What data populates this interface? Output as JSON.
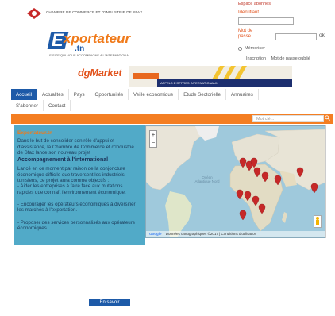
{
  "header": {
    "org_name": "CHAMBRE DE COMMERCE ET D'INDUSTRIE DE SFAX",
    "logo": {
      "brand": "xportateur",
      "e_letter": "E",
      "tld": ".tn",
      "slogan": "LE SITE QUI VOUS ACCOMPAGNE A L'INTERNATIONAL"
    }
  },
  "login": {
    "title": "Espace abonnés",
    "identifiant_label": "Identifiant",
    "password_label": "Mot de passe",
    "ok_label": "ok",
    "remember_label": "Mémoriser",
    "signup_link": "Inscription",
    "forgot_link": "Mot de passe oublié"
  },
  "banner": {
    "brand": "dgMarket",
    "promo_text": "APPELS D'OFFRES INTERNATIONAUX"
  },
  "nav": {
    "row1": [
      "Accueil",
      "Actualités",
      "Pays",
      "Opportunités",
      "Veille économique",
      "Etude Sectorielle",
      "Annuaires"
    ],
    "row2": [
      "S'abonner",
      "Contact"
    ],
    "active": "Accueil"
  },
  "search": {
    "placeholder": "Mot clé..."
  },
  "intro": {
    "title": "Exportateur.tn",
    "p1": "Dans le but de consolider son rôle d'appui et d'assistance, la Chambre de Commerce et d'Industrie de Sfax lance son nouveau projet",
    "heading": "Accompagnement à l'international",
    "p2": "Lancé en ce moment par raison de la conjoncture économique difficile que traversent les industriels tunisiens, ce projet aura comme objectifs :",
    "b1": "- Aider les entreprises à faire face aux mutations rapides que connaît l'environnement économique.",
    "b2": "- Encourager les opérateurs économiques à diversifier les marchés à l'exportation.",
    "b3": "- Proposer des services personnalisés aux opérateurs économiques.",
    "more_button": "En savoir"
  },
  "map": {
    "zoom_in": "+",
    "zoom_out": "−",
    "ocean_label": "Océan Atlantique Nord",
    "google": "Google",
    "footer": "Données cartographiques ©2017 | Conditions d'utilisation",
    "marker_color": "#c62828"
  }
}
